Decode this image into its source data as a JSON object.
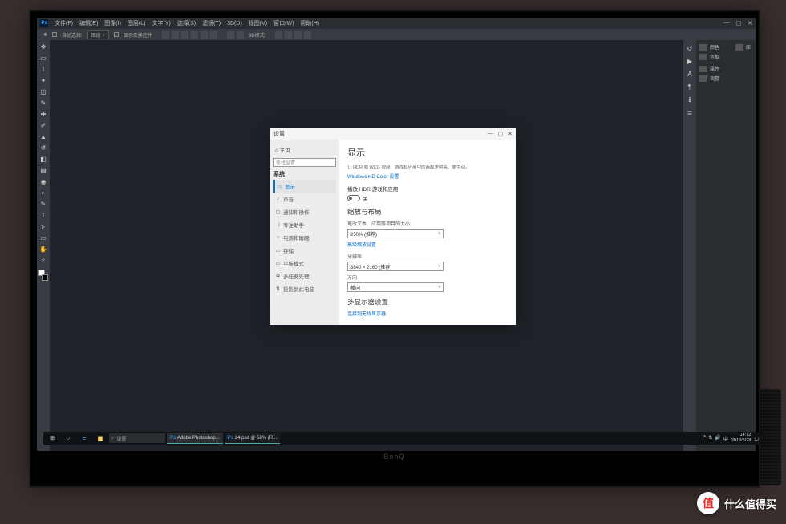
{
  "ps": {
    "logo": "Ps",
    "menus": [
      "文件(F)",
      "编辑(E)",
      "图像(I)",
      "图层(L)",
      "文字(Y)",
      "选择(S)",
      "滤镜(T)",
      "3D(D)",
      "视图(V)",
      "窗口(W)",
      "帮助(H)"
    ],
    "opt_auto": "自动选择:",
    "opt_layer": "图层",
    "opt_transform": "显示变换控件",
    "opt_3d": "3D模式:",
    "panels": [
      "颜色",
      "色板",
      "属性",
      "调整",
      "库"
    ]
  },
  "settings": {
    "title": "设置",
    "side": {
      "home": "主页",
      "search_ph": "查找设置",
      "category": "系统",
      "items": [
        {
          "icon": "▭",
          "label": "显示",
          "active": true
        },
        {
          "icon": "♪",
          "label": "声音"
        },
        {
          "icon": "▢",
          "label": "通知和操作"
        },
        {
          "icon": "☽",
          "label": "专注助手"
        },
        {
          "icon": "○",
          "label": "电源和睡眠"
        },
        {
          "icon": "▭",
          "label": "存储"
        },
        {
          "icon": "▭",
          "label": "平板模式"
        },
        {
          "icon": "⧉",
          "label": "多任务处理"
        },
        {
          "icon": "⇅",
          "label": "投影到此电脑"
        }
      ]
    },
    "main": {
      "heading": "显示",
      "hdr_desc": "让 HDR 和 WCG 视频、游戏和应用中的画面更明亮、更生动。",
      "hdr_link": "Windows HD Color 设置",
      "nl_label": "播放 HDR 游戏和应用",
      "nl_state": "关",
      "scale_heading": "缩放与布局",
      "scale_sub": "更改文本、应用等项目的大小",
      "scale_val": "250% (推荐)",
      "scale_link": "高级缩放设置",
      "res_sub": "分辨率",
      "res_val": "3840 × 2160 (推荐)",
      "orient_sub": "方向",
      "orient_val": "横向",
      "multi_heading": "多显示器设置",
      "multi_link": "连接到无线显示器"
    }
  },
  "taskbar": {
    "search": "设置",
    "tasks": [
      "Adobe Photoshop...",
      "24.psd @ 50% (R..."
    ],
    "time": "14:12",
    "date": "2019/5/28"
  },
  "watermark": {
    "char": "值",
    "text": "什么值得买"
  },
  "monitor_brand": "BenQ"
}
